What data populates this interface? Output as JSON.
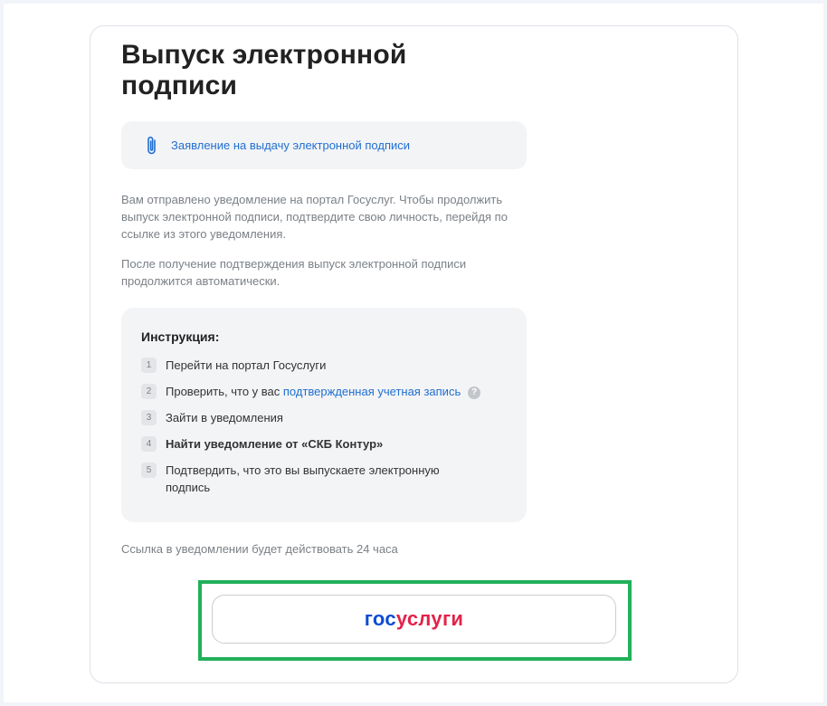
{
  "title": "Выпуск электронной подписи",
  "document_link": {
    "icon": "paperclip-icon",
    "label": "Заявление на выдачу электронной подписи"
  },
  "paragraphs": [
    "Вам отправлено уведомление на портал Госуслуг. Чтобы продолжить выпуск электронной подписи, подтвердите свою личность, перейдя по ссылке из этого уведомления.",
    "После получение подтверждения выпуск электронной подписи продолжится автоматически."
  ],
  "instructions": {
    "title": "Инструкция:",
    "steps": [
      {
        "num": "1",
        "text": "Перейти на портал Госуслуги"
      },
      {
        "num": "2",
        "text": "Проверить, что у вас ",
        "link": "подтвержденная учетная запись",
        "help": "?"
      },
      {
        "num": "3",
        "text": "Зайти в уведомления"
      },
      {
        "num": "4",
        "text": "Найти уведомление от «СКБ Контур»"
      },
      {
        "num": "5",
        "text": "Подтвердить, что это вы выпускаете электронную подпись"
      }
    ]
  },
  "note": "Ссылка в уведомлении будет действовать 24 часа",
  "gosuslugi_button": {
    "logo_part1": "гос",
    "logo_part2": "услуги",
    "colors": {
      "gos": "#0d4cd3",
      "uslugi": "#e3224a"
    }
  },
  "highlight_color": "#22b05a",
  "link_color": "#1f6fd1"
}
